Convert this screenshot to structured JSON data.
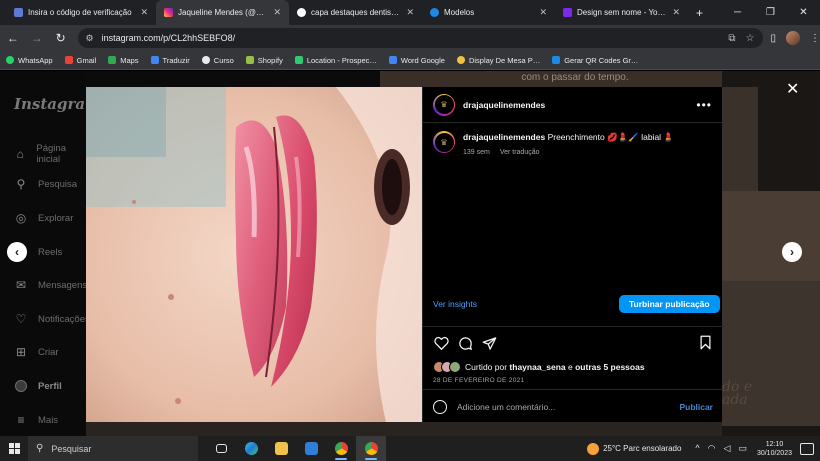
{
  "browser": {
    "tabs": [
      {
        "title": "Insira o código de verificação",
        "favicon_color": "#5b7bd5",
        "active": false
      },
      {
        "title": "Jaqueline Mendes (@draja…",
        "favicon_color": "#e1306c",
        "active": true
      },
      {
        "title": "capa destaques dentista - P…",
        "favicon_color": "#4285f4",
        "active": false
      },
      {
        "title": "Modelos",
        "favicon_color": "#1e88e5",
        "active": false
      },
      {
        "title": "Design sem nome - Your St…",
        "favicon_color": "#7d2ae8",
        "active": false
      }
    ],
    "url": "instagram.com/p/CL2hhSEBFO8/",
    "bookmarks": [
      {
        "label": "WhatsApp",
        "color": "#25d366"
      },
      {
        "label": "Gmail",
        "color": "#ea4335"
      },
      {
        "label": "Maps",
        "color": "#34a853"
      },
      {
        "label": "Traduzir",
        "color": "#4285f4"
      },
      {
        "label": "Curso",
        "color": "#e8eaed"
      },
      {
        "label": "Shopify",
        "color": "#95bf47"
      },
      {
        "label": "Location - Prospec…",
        "color": "#2ecc71"
      },
      {
        "label": "Word Google",
        "color": "#4285f4"
      },
      {
        "label": "Display De Mesa P…",
        "color": "#f0c040"
      },
      {
        "label": "Gerar QR Codes Gr…",
        "color": "#1e88e5"
      }
    ]
  },
  "instagram": {
    "logo": "Instagram",
    "sidebar": [
      {
        "label": "Página inicial",
        "icon": "home-icon",
        "glyph": "⌂"
      },
      {
        "label": "Pesquisa",
        "icon": "search-icon",
        "glyph": "⚲"
      },
      {
        "label": "Explorar",
        "icon": "compass-icon",
        "glyph": "◎"
      },
      {
        "label": "Reels",
        "icon": "reels-icon",
        "glyph": "▣"
      },
      {
        "label": "Mensagens",
        "icon": "messenger-icon",
        "glyph": "✉"
      },
      {
        "label": "Notificações",
        "icon": "heart-icon",
        "glyph": "♡"
      },
      {
        "label": "Criar",
        "icon": "plus-square-icon",
        "glyph": "⊞"
      },
      {
        "label": "Perfil",
        "icon": "profile-icon",
        "glyph": "●"
      },
      {
        "label": "Mais",
        "icon": "menu-icon",
        "glyph": "≡"
      }
    ],
    "bg_top_text": "com o passar do tempo."
  },
  "post": {
    "username": "drajaquelinemendes",
    "caption": "Preenchimento 💋💄🖌️ labial 💄",
    "time_ago": "139 sem",
    "translate": "Ver tradução",
    "insights": "Ver insights",
    "boost": "Turbinar publicação",
    "liked_by_prefix": "Curtido por ",
    "liked_by_user": "thaynaa_sena",
    "liked_by_suffix": " e ",
    "liked_by_others": "outras 5 pessoas",
    "date": "28 DE FEVEREIRO DE 2021",
    "comment_placeholder": "Adicione um comentário...",
    "publish": "Publicar"
  },
  "taskbar": {
    "search": "Pesquisar",
    "weather": "25°C  Parc ensolarado",
    "time": "12:10",
    "date": "30/10/2023"
  }
}
